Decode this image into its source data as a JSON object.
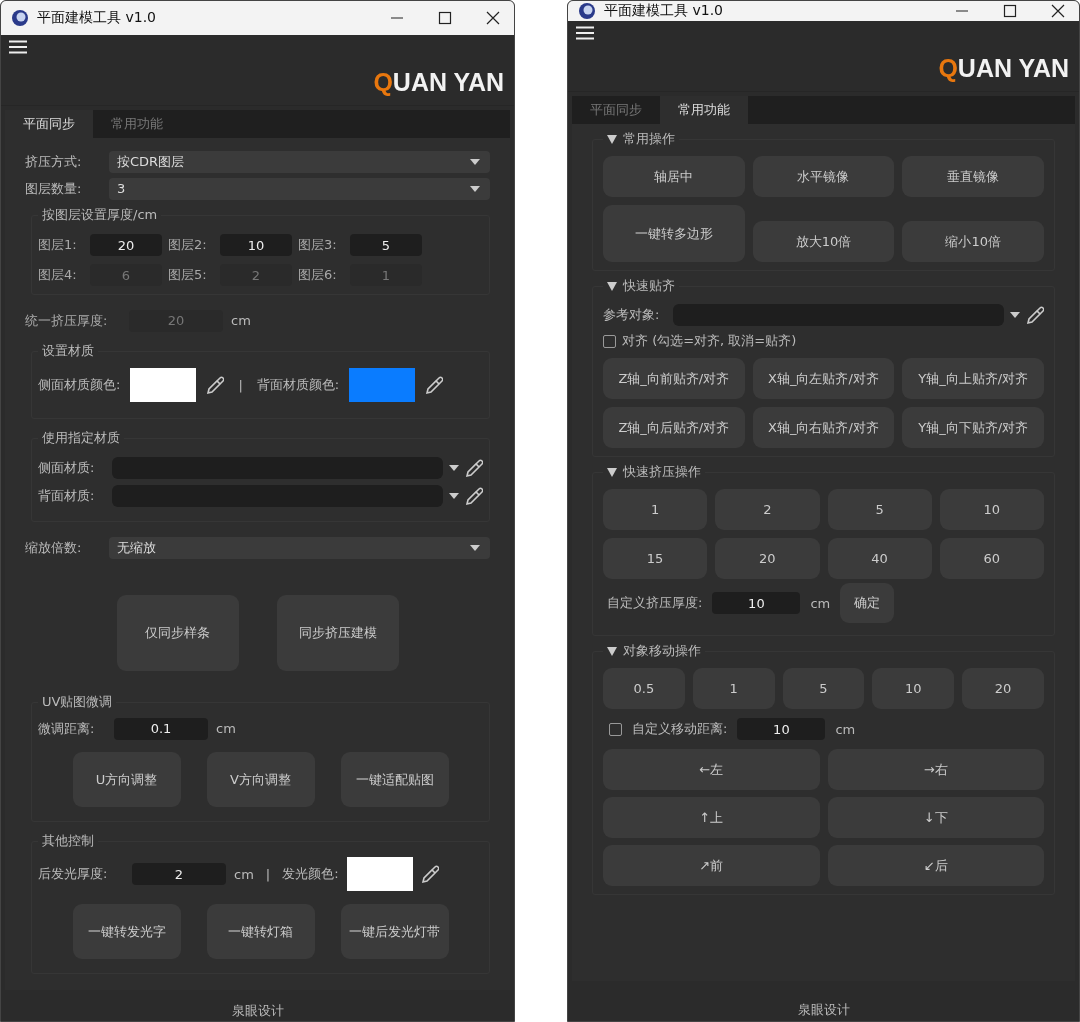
{
  "windows": [
    {
      "title": "平面建模工具 v1.0",
      "logo": {
        "accent": "Q",
        "rest": "UAN YAN"
      },
      "tabs": [
        {
          "label": "平面同步",
          "selected": true
        },
        {
          "label": "常用功能",
          "selected": false
        }
      ],
      "page": {
        "kind": "sync",
        "combos": [
          {
            "label": "挤压方式:",
            "value": "按CDR图层"
          },
          {
            "label": "图层数量:",
            "value": "3"
          }
        ],
        "layers": {
          "title": "按图层设置厚度/cm",
          "items": [
            {
              "label": "图层1:",
              "value": "20",
              "disabled": false
            },
            {
              "label": "图层2:",
              "value": "10",
              "disabled": false
            },
            {
              "label": "图层3:",
              "value": "5",
              "disabled": false
            },
            {
              "label": "图层4:",
              "value": "6",
              "disabled": true
            },
            {
              "label": "图层5:",
              "value": "2",
              "disabled": true
            },
            {
              "label": "图层6:",
              "value": "1",
              "disabled": true
            }
          ]
        },
        "uniform": {
          "label": "统一挤压厚度:",
          "value": "20",
          "unit": "cm",
          "disabled": true
        },
        "material": {
          "title": "设置材质",
          "separator": "|",
          "swatches": [
            {
              "label": "侧面材质颜色:",
              "color": "#ffffff"
            },
            {
              "label": "背面材质颜色:",
              "color": "#0a7cff"
            }
          ]
        },
        "assigned": {
          "title": "使用指定材质",
          "rows": [
            {
              "label": "侧面材质:"
            },
            {
              "label": "背面材质:"
            }
          ]
        },
        "scale": {
          "label": "缩放倍数:",
          "value": "无缩放"
        },
        "actions": [
          "仅同步样条",
          "同步挤压建模"
        ],
        "uv": {
          "title": "UV贴图微调",
          "label": "微调距离:",
          "value": "0.1",
          "unit": "cm",
          "buttons": [
            "U方向调整",
            "V方向调整",
            "一键适配贴图"
          ]
        },
        "other": {
          "title": "其他控制",
          "label": "后发光厚度:",
          "value": "2",
          "unit": "cm",
          "separator": "|",
          "color_label": "发光颜色:",
          "color": "#ffffff",
          "buttons": [
            "一键转发光字",
            "一键转灯箱",
            "一键后发光灯带"
          ]
        }
      },
      "footer": "泉眼设计"
    },
    {
      "title": "平面建模工具 v1.0",
      "logo": {
        "accent": "Q",
        "rest": "UAN YAN"
      },
      "tabs": [
        {
          "label": "平面同步",
          "selected": false
        },
        {
          "label": "常用功能",
          "selected": true
        }
      ],
      "page": {
        "kind": "common",
        "sections": [
          {
            "kind": "grid3",
            "title": "常用操作",
            "expanded": true,
            "buttons": [
              "轴居中",
              "水平镜像",
              "垂直镜像",
              "一键转多边形",
              "放大10倍",
              "缩小10倍"
            ]
          },
          {
            "kind": "snap",
            "title": "快速贴齐",
            "expanded": true,
            "ref_label": "参考对象:",
            "align": {
              "label": "对齐 (勾选=对齐, 取消=贴齐)",
              "checked": false
            },
            "buttons": [
              "Z轴_向前贴齐/对齐",
              "X轴_向左贴齐/对齐",
              "Y轴_向上贴齐/对齐",
              "Z轴_向后贴齐/对齐",
              "X轴_向右贴齐/对齐",
              "Y轴_向下贴齐/对齐"
            ]
          },
          {
            "kind": "extrude",
            "title": "快速挤压操作",
            "expanded": true,
            "buttons": [
              "1",
              "2",
              "5",
              "10",
              "15",
              "20",
              "40",
              "60"
            ],
            "custom": {
              "label": "自定义挤压厚度:",
              "value": "10",
              "unit": "cm",
              "button": "确定"
            }
          },
          {
            "kind": "move",
            "title": "对象移动操作",
            "expanded": true,
            "steps": [
              "0.5",
              "1",
              "5",
              "10",
              "20"
            ],
            "custom": {
              "label": "自定义移动距离:",
              "value": "10",
              "unit": "cm",
              "checked": false
            },
            "directions": [
              "←左",
              "→右",
              "↑上",
              "↓下",
              "↗前",
              "↙后"
            ]
          }
        ]
      },
      "footer": "泉眼设计"
    }
  ]
}
